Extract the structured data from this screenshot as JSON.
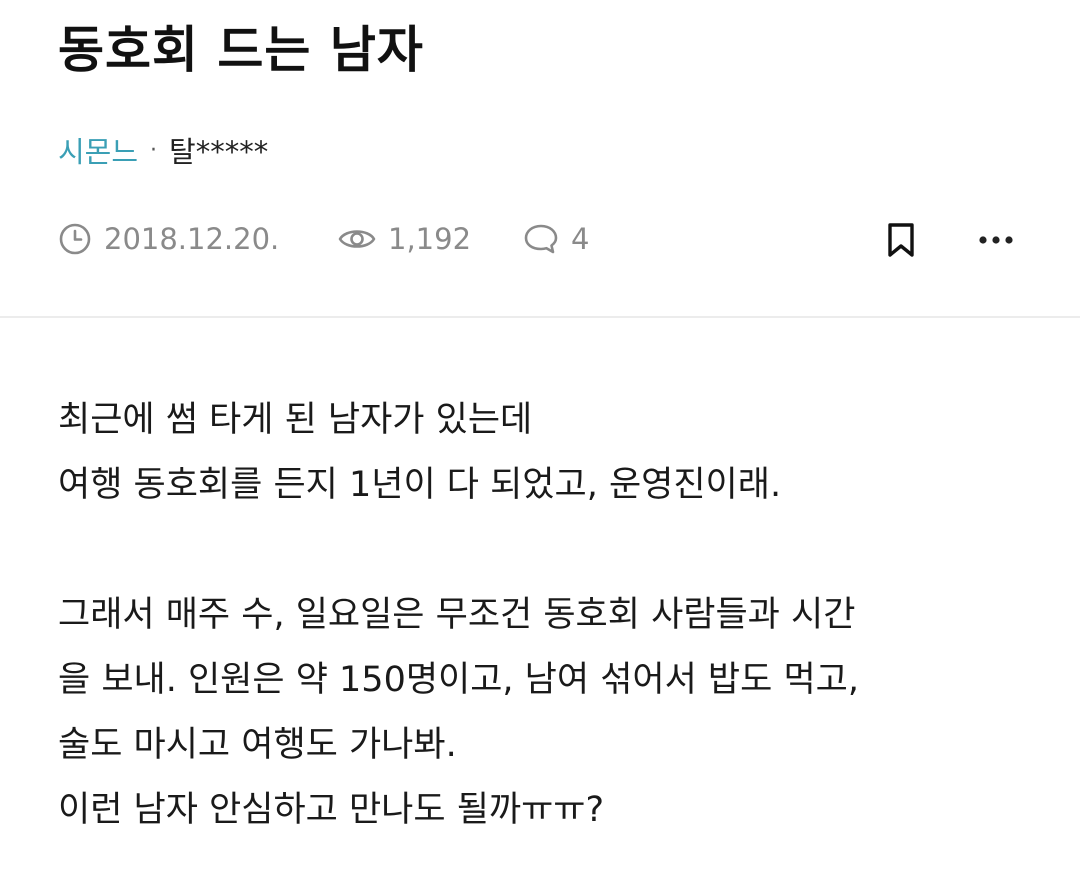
{
  "post": {
    "title": "동호회 드는 남자",
    "cafe_name": "시몬느",
    "separator": "·",
    "author": "탈*****",
    "date": "2018.12.20.",
    "views": "1,192",
    "comments": "4",
    "icons": {
      "date": "clock-icon",
      "views": "eye-icon",
      "comments": "comment-bubble-icon",
      "bookmark": "bookmark-icon",
      "more": "more-dots-icon"
    },
    "body": {
      "paragraph1": [
        "최근에 썸 타게 된 남자가 있는데",
        "여행 동호회를 든지 1년이 다 되었고, 운영진이래."
      ],
      "paragraph2": [
        "그래서 매주 수, 일요일은 무조건 동호회 사람들과 시간",
        "을 보내. 인원은 약 150명이고, 남여 섞어서 밥도 먹고,",
        "술도 마시고 여행도 가나봐.",
        "이런 남자 안심하고 만나도 될까ㅠㅠ?"
      ]
    }
  },
  "colors": {
    "accent": "#3a9fb5",
    "meta_gray": "#8a8a8a",
    "text": "#111111",
    "divider": "#ececec"
  }
}
